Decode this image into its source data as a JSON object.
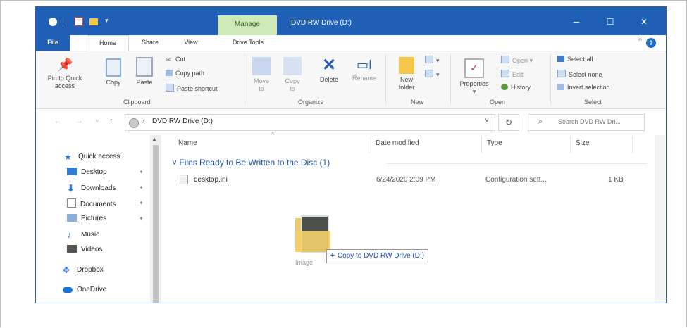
{
  "titlebar": {
    "manage_tab": "Manage",
    "title": "DVD RW Drive (D:)",
    "minimize_icon": "─",
    "maximize_icon": "☐",
    "close_icon": "✕",
    "quick_access_dropdown": "▾"
  },
  "tabs": [
    {
      "label": "File"
    },
    {
      "label": "Home"
    },
    {
      "label": "Share"
    },
    {
      "label": "View"
    },
    {
      "label": "Drive Tools"
    }
  ],
  "ribbon": {
    "collapse_glyph": "^",
    "help_glyph": "?",
    "clipboard": {
      "pin": "Pin to Quick",
      "pin2": "access",
      "copy": "Copy",
      "paste": "Paste",
      "cut": "Cut",
      "copy_path": "Copy path",
      "paste_shortcut": "Paste shortcut",
      "group": "Clipboard"
    },
    "organize": {
      "move": "Move",
      "move2": "to",
      "copy": "Copy",
      "copy2": "to",
      "delete": "Delete",
      "rename": "Rename",
      "group": "Organize"
    },
    "new": {
      "new_folder": "New",
      "new_folder2": "folder",
      "group": "New"
    },
    "open": {
      "properties": "Properties",
      "open": "Open",
      "edit": "Edit",
      "history": "History",
      "group": "Open"
    },
    "select": {
      "select_all": "Select all",
      "select_none": "Select none",
      "invert": "Invert selection",
      "group": "Select"
    }
  },
  "address": {
    "back": "←",
    "forward": "→",
    "recent": "˅",
    "up": "↑",
    "chevron": "›",
    "path": "DVD RW Drive (D:)",
    "dropdown": "˅",
    "refresh": "↻",
    "search_icon": "⌕",
    "search_placeholder": "Search DVD RW Dri..."
  },
  "nav": {
    "scroll_up": "▲",
    "items": [
      {
        "label": "Quick access",
        "icon": "star-icon",
        "glyph": "★"
      },
      {
        "label": "Desktop",
        "icon": "desktop-icon",
        "pinned": true
      },
      {
        "label": "Downloads",
        "icon": "download-icon",
        "glyph": "⬇",
        "pinned": true
      },
      {
        "label": "Documents",
        "icon": "documents-icon",
        "pinned": true
      },
      {
        "label": "Pictures",
        "icon": "pictures-icon",
        "pinned": true
      },
      {
        "label": "Music",
        "icon": "music-icon",
        "glyph": "♪"
      },
      {
        "label": "Videos",
        "icon": "videos-icon"
      },
      {
        "label": "Dropbox",
        "icon": "dropbox-icon",
        "glyph": "✥"
      },
      {
        "label": "OneDrive",
        "icon": "onedrive-icon"
      }
    ],
    "pin_glyph": "✦"
  },
  "columns": {
    "name": "Name",
    "date": "Date modified",
    "type": "Type",
    "size": "Size",
    "sort_arrow": "^"
  },
  "group": {
    "chevron": "˅",
    "label": "Files Ready to Be Written to the Disc (1)"
  },
  "files": [
    {
      "name": "desktop.ini",
      "date": "6/24/2020 2:09 PM",
      "type": "Configuration sett...",
      "size": "1 KB"
    }
  ],
  "drag": {
    "label": "Image",
    "tip_plus": "+",
    "tip": "Copy to DVD RW Drive (D:)"
  },
  "colors": {
    "accent": "#1f5fb5",
    "manage_tab_bg": "#cfe9b8",
    "group_header": "#1e4fa5"
  }
}
